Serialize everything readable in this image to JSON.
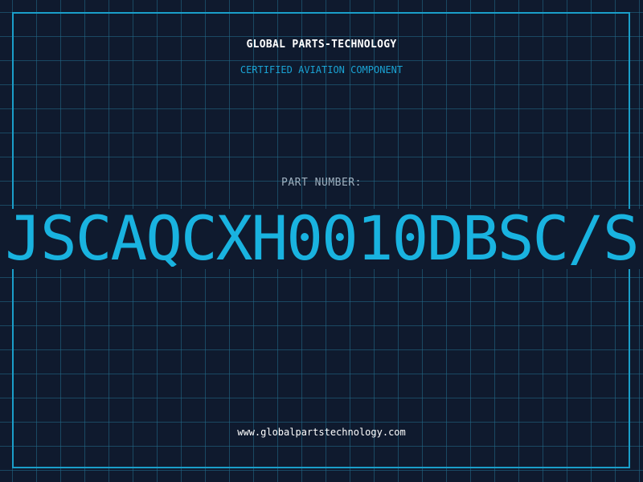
{
  "header": {
    "company_name": "GLOBAL PARTS-TECHNOLOGY",
    "subtitle": "CERTIFIED AVIATION COMPONENT"
  },
  "part": {
    "label": "PART NUMBER:",
    "number": "JSCAQCXH0010DBSC/S"
  },
  "footer": {
    "website": "www.globalpartstechnology.com"
  },
  "colors": {
    "background": "#0f1a2e",
    "grid": "#226e8c",
    "accent": "#19b3e0",
    "frame": "#1a9ec9",
    "label": "#9fb0bf",
    "text": "#ffffff"
  }
}
